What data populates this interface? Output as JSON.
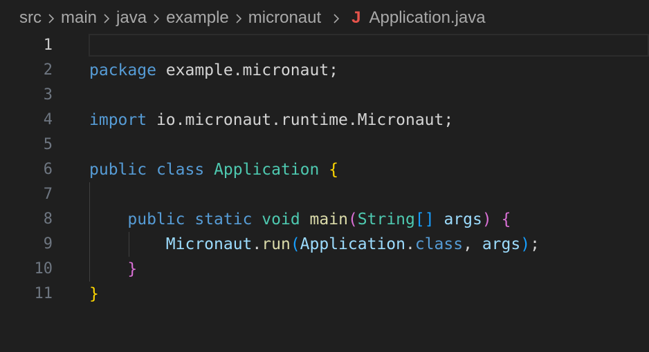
{
  "breadcrumb": {
    "items": [
      "src",
      "main",
      "java",
      "example",
      "micronaut"
    ],
    "file_icon": "J",
    "file_name": "Application.java"
  },
  "editor": {
    "active_line": 1,
    "lines": [
      {
        "number": "1",
        "tokens": []
      },
      {
        "number": "2",
        "tokens": [
          {
            "text": "package",
            "cls": "kw"
          },
          {
            "text": " example.micronaut;",
            "cls": "pl"
          }
        ]
      },
      {
        "number": "3",
        "tokens": []
      },
      {
        "number": "4",
        "tokens": [
          {
            "text": "import",
            "cls": "kw"
          },
          {
            "text": " io.micronaut.runtime.Micronaut;",
            "cls": "pl"
          }
        ]
      },
      {
        "number": "5",
        "tokens": []
      },
      {
        "number": "6",
        "tokens": [
          {
            "text": "public",
            "cls": "kw"
          },
          {
            "text": " ",
            "cls": "pl"
          },
          {
            "text": "class",
            "cls": "kw"
          },
          {
            "text": " ",
            "cls": "pl"
          },
          {
            "text": "Application",
            "cls": "ty"
          },
          {
            "text": " ",
            "cls": "pl"
          },
          {
            "text": "{",
            "cls": "b1"
          }
        ]
      },
      {
        "number": "7",
        "tokens": []
      },
      {
        "number": "8",
        "tokens": [
          {
            "text": "    ",
            "cls": "pl"
          },
          {
            "text": "public",
            "cls": "kw"
          },
          {
            "text": " ",
            "cls": "pl"
          },
          {
            "text": "static",
            "cls": "kw"
          },
          {
            "text": " ",
            "cls": "pl"
          },
          {
            "text": "void",
            "cls": "ty"
          },
          {
            "text": " ",
            "cls": "pl"
          },
          {
            "text": "main",
            "cls": "fn"
          },
          {
            "text": "(",
            "cls": "b2"
          },
          {
            "text": "String",
            "cls": "ty"
          },
          {
            "text": "[]",
            "cls": "b3"
          },
          {
            "text": " ",
            "cls": "pl"
          },
          {
            "text": "args",
            "cls": "va"
          },
          {
            "text": ")",
            "cls": "b2"
          },
          {
            "text": " ",
            "cls": "pl"
          },
          {
            "text": "{",
            "cls": "b2"
          }
        ]
      },
      {
        "number": "9",
        "tokens": [
          {
            "text": "        ",
            "cls": "pl"
          },
          {
            "text": "Micronaut",
            "cls": "va"
          },
          {
            "text": ".",
            "cls": "pl"
          },
          {
            "text": "run",
            "cls": "fn"
          },
          {
            "text": "(",
            "cls": "b3"
          },
          {
            "text": "Application",
            "cls": "va"
          },
          {
            "text": ".",
            "cls": "pl"
          },
          {
            "text": "class",
            "cls": "kw"
          },
          {
            "text": ", ",
            "cls": "pl"
          },
          {
            "text": "args",
            "cls": "va"
          },
          {
            "text": ")",
            "cls": "b3"
          },
          {
            "text": ";",
            "cls": "pl"
          }
        ]
      },
      {
        "number": "10",
        "tokens": [
          {
            "text": "    ",
            "cls": "pl"
          },
          {
            "text": "}",
            "cls": "b2"
          }
        ]
      },
      {
        "number": "11",
        "tokens": [
          {
            "text": "}",
            "cls": "b1"
          }
        ]
      }
    ]
  },
  "colors": {
    "background": "#1f1f1f",
    "keyword": "#569cd6",
    "type": "#4ec9b0",
    "function": "#dcdcaa",
    "variable": "#9cdcfe",
    "bracket_level1": "#ffd700",
    "bracket_level2": "#da70d6",
    "bracket_level3": "#179fff",
    "java_icon": "#e5534b"
  }
}
